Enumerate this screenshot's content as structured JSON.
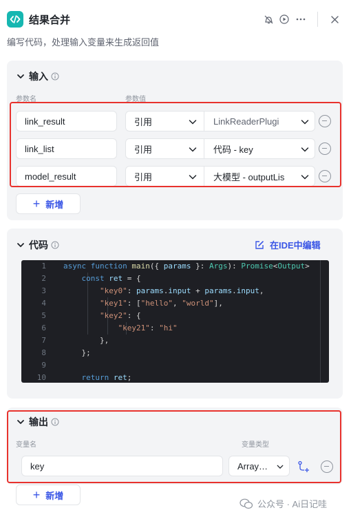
{
  "header": {
    "title": "结果合并",
    "description": "编写代码，处理输入变量来生成返回值",
    "icons": [
      "code-icon",
      "no-debug-icon",
      "run-icon",
      "more-icon",
      "close-icon"
    ]
  },
  "input": {
    "title": "输入",
    "col_name": "参数名",
    "col_value": "参数值",
    "rows": [
      {
        "name": "link_result",
        "type": "引用",
        "value": "LinkReaderPlugi"
      },
      {
        "name": "link_list",
        "type": "引用",
        "value": "代码 - key"
      },
      {
        "name": "model_result",
        "type": "引用",
        "value": "大模型 - outputLis"
      }
    ],
    "add_label": "新增"
  },
  "code": {
    "title": "代码",
    "ide_label": "在IDE中编辑",
    "line_numbers": [
      "1",
      "2",
      "3",
      "4",
      "5",
      "6",
      "7",
      "8",
      "9",
      "10"
    ],
    "lines": [
      [
        [
          "kw",
          "async "
        ],
        [
          "kw",
          "function "
        ],
        [
          "fn",
          "main"
        ],
        [
          "p",
          "({ "
        ],
        [
          "pr",
          "params"
        ],
        [
          "p",
          " }: "
        ],
        [
          "ty",
          "Args"
        ],
        [
          "p",
          "): "
        ],
        [
          "ty",
          "Promise"
        ],
        [
          "p",
          "<"
        ],
        [
          "ty",
          "Output"
        ],
        [
          "p",
          ">"
        ]
      ],
      [
        [
          "p",
          "    "
        ],
        [
          "kw",
          "const "
        ],
        [
          "pr",
          "ret"
        ],
        [
          "p",
          " = {"
        ]
      ],
      [
        [
          "p",
          "        "
        ],
        [
          "st",
          "\"key0\""
        ],
        [
          "p",
          ": "
        ],
        [
          "pr",
          "params"
        ],
        [
          "p",
          "."
        ],
        [
          "pr",
          "input"
        ],
        [
          "p",
          " + "
        ],
        [
          "pr",
          "params"
        ],
        [
          "p",
          "."
        ],
        [
          "pr",
          "input"
        ],
        [
          "p",
          ","
        ]
      ],
      [
        [
          "p",
          "        "
        ],
        [
          "st",
          "\"key1\""
        ],
        [
          "p",
          ": ["
        ],
        [
          "st",
          "\"hello\""
        ],
        [
          "p",
          ", "
        ],
        [
          "st",
          "\"world\""
        ],
        [
          "p",
          "],"
        ]
      ],
      [
        [
          "p",
          "        "
        ],
        [
          "st",
          "\"key2\""
        ],
        [
          "p",
          ": {"
        ]
      ],
      [
        [
          "p",
          "            "
        ],
        [
          "st",
          "\"key21\""
        ],
        [
          "p",
          ": "
        ],
        [
          "st",
          "\"hi\""
        ]
      ],
      [
        [
          "p",
          "        },"
        ]
      ],
      [
        [
          "p",
          "    };"
        ]
      ],
      [
        [
          "p",
          ""
        ]
      ],
      [
        [
          "p",
          "    "
        ],
        [
          "kw",
          "return "
        ],
        [
          "pr",
          "ret"
        ],
        [
          "p",
          ";"
        ]
      ]
    ]
  },
  "output": {
    "title": "输出",
    "col_name": "变量名",
    "col_type": "变量类型",
    "rows": [
      {
        "name": "key",
        "type": "Array…"
      }
    ],
    "add_label": "新增"
  },
  "watermark": "公众号 · Ai日记哇",
  "colors": {
    "accent": "#3a56e6",
    "highlight_border": "#e8322d",
    "panel_bg": "#f3f4f6",
    "code_bg": "#1e1f24",
    "app_icon": "#16b7b1"
  }
}
